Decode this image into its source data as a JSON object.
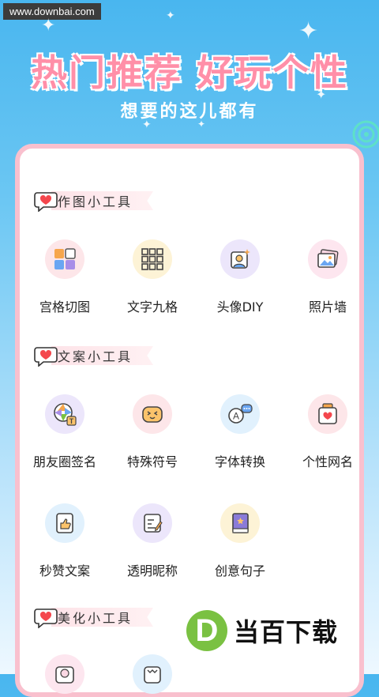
{
  "watermark": "www.downbai.com",
  "hero": {
    "title": "热门推荐  好玩个性",
    "subtitle": "想要的这儿都有"
  },
  "sections": [
    {
      "title": "作图小工具",
      "tools": [
        {
          "label": "宫格切图",
          "icon": "grid-cut-icon",
          "bg": "#fde6e9"
        },
        {
          "label": "文字九格",
          "icon": "nine-grid-icon",
          "bg": "#fdf3d6"
        },
        {
          "label": "头像DIY",
          "icon": "avatar-diy-icon",
          "bg": "#ece6fb"
        },
        {
          "label": "照片墙",
          "icon": "photo-wall-icon",
          "bg": "#fde6ef"
        }
      ]
    },
    {
      "title": "文案小工具",
      "tools": [
        {
          "label": "朋友圈签名",
          "icon": "moments-sign-icon",
          "bg": "#ece6fb"
        },
        {
          "label": "特殊符号",
          "icon": "emoji-symbol-icon",
          "bg": "#fde6e9"
        },
        {
          "label": "字体转换",
          "icon": "font-convert-icon",
          "bg": "#e1f1fd"
        },
        {
          "label": "个性网名",
          "icon": "nickname-icon",
          "bg": "#fde6e9"
        },
        {
          "label": "秒赞文案",
          "icon": "like-icon",
          "bg": "#e1f1fd"
        },
        {
          "label": "透明昵称",
          "icon": "transparent-name-icon",
          "bg": "#ece6fb"
        },
        {
          "label": "创意句子",
          "icon": "book-icon",
          "bg": "#fdf3d6"
        }
      ]
    },
    {
      "title": "美化小工具",
      "tools": [
        {
          "label": "",
          "icon": "beautify-icon-1",
          "bg": "#fde6ef"
        },
        {
          "label": "",
          "icon": "beautify-icon-2",
          "bg": "#e1f1fd"
        }
      ]
    }
  ],
  "brand": {
    "mark": "D",
    "name": "当百下载"
  }
}
